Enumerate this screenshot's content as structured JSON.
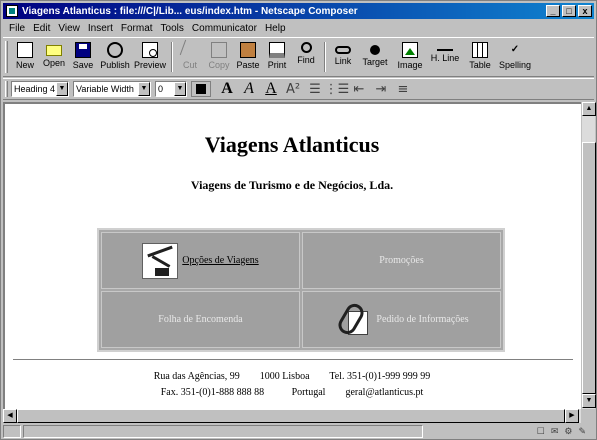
{
  "window": {
    "title": "Viagens Atlanticus : file:///C|/Lib... eus/index.htm - Netscape Composer",
    "min_label": "_",
    "max_label": "□",
    "close_label": "x"
  },
  "menubar": {
    "items": [
      "File",
      "Edit",
      "View",
      "Insert",
      "Format",
      "Tools",
      "Communicator",
      "Help"
    ]
  },
  "toolbar": {
    "new": "New",
    "open": "Open",
    "save": "Save",
    "publish": "Publish",
    "preview": "Preview",
    "cut": "Cut",
    "copy": "Copy",
    "paste": "Paste",
    "print": "Print",
    "find": "Find",
    "link": "Link",
    "target": "Target",
    "image": "Image",
    "hline": "H. Line",
    "table": "Table",
    "spelling": "Spelling"
  },
  "format_toolbar": {
    "paragraph_style": "Heading 4",
    "font": "Variable Width",
    "font_size": "0",
    "bold_glyph": "A",
    "italic_glyph": "A",
    "underline_glyph": "A",
    "clear_glyph": "A²",
    "bullet_glyph": "☰",
    "numbered_glyph": "⋮☰",
    "outdent_glyph": "⇤",
    "indent_glyph": "⇥",
    "align_glyph": "≡"
  },
  "page": {
    "title": "Viagens Atlanticus",
    "subtitle": "Viagens de Turismo e de Negócios, Lda.",
    "nav": {
      "opcoes": "Opções de Viagens",
      "promocoes": "Promoções",
      "folha": "Folha de Encomenda",
      "pedido": "Pedido de Informações"
    },
    "footer": {
      "line1": "Rua das Agências, 99        1000 Lisboa        Tel. 351-(0)1-999 999 99",
      "line2": "Fax. 351-(0)1-888 888 88           Portugal        geral@atlanticus.pt"
    }
  },
  "statusbar": {
    "icons": [
      "☐",
      "✉",
      "⚙",
      "✎"
    ]
  }
}
